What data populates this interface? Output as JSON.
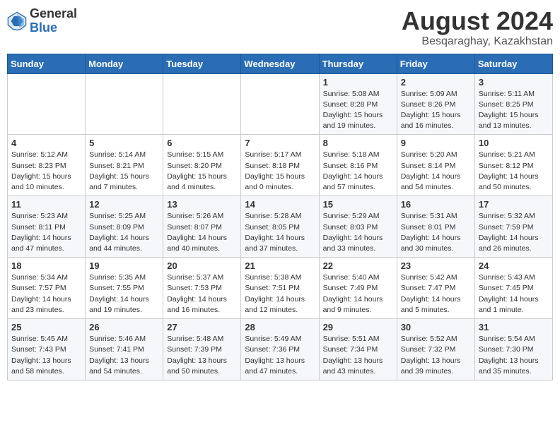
{
  "logo": {
    "general": "General",
    "blue": "Blue"
  },
  "title": "August 2024",
  "location": "Besqaraghay, Kazakhstan",
  "days_header": [
    "Sunday",
    "Monday",
    "Tuesday",
    "Wednesday",
    "Thursday",
    "Friday",
    "Saturday"
  ],
  "weeks": [
    [
      {
        "day": "",
        "info": ""
      },
      {
        "day": "",
        "info": ""
      },
      {
        "day": "",
        "info": ""
      },
      {
        "day": "",
        "info": ""
      },
      {
        "day": "1",
        "info": "Sunrise: 5:08 AM\nSunset: 8:28 PM\nDaylight: 15 hours\nand 19 minutes."
      },
      {
        "day": "2",
        "info": "Sunrise: 5:09 AM\nSunset: 8:26 PM\nDaylight: 15 hours\nand 16 minutes."
      },
      {
        "day": "3",
        "info": "Sunrise: 5:11 AM\nSunset: 8:25 PM\nDaylight: 15 hours\nand 13 minutes."
      }
    ],
    [
      {
        "day": "4",
        "info": "Sunrise: 5:12 AM\nSunset: 8:23 PM\nDaylight: 15 hours\nand 10 minutes."
      },
      {
        "day": "5",
        "info": "Sunrise: 5:14 AM\nSunset: 8:21 PM\nDaylight: 15 hours\nand 7 minutes."
      },
      {
        "day": "6",
        "info": "Sunrise: 5:15 AM\nSunset: 8:20 PM\nDaylight: 15 hours\nand 4 minutes."
      },
      {
        "day": "7",
        "info": "Sunrise: 5:17 AM\nSunset: 8:18 PM\nDaylight: 15 hours\nand 0 minutes."
      },
      {
        "day": "8",
        "info": "Sunrise: 5:18 AM\nSunset: 8:16 PM\nDaylight: 14 hours\nand 57 minutes."
      },
      {
        "day": "9",
        "info": "Sunrise: 5:20 AM\nSunset: 8:14 PM\nDaylight: 14 hours\nand 54 minutes."
      },
      {
        "day": "10",
        "info": "Sunrise: 5:21 AM\nSunset: 8:12 PM\nDaylight: 14 hours\nand 50 minutes."
      }
    ],
    [
      {
        "day": "11",
        "info": "Sunrise: 5:23 AM\nSunset: 8:11 PM\nDaylight: 14 hours\nand 47 minutes."
      },
      {
        "day": "12",
        "info": "Sunrise: 5:25 AM\nSunset: 8:09 PM\nDaylight: 14 hours\nand 44 minutes."
      },
      {
        "day": "13",
        "info": "Sunrise: 5:26 AM\nSunset: 8:07 PM\nDaylight: 14 hours\nand 40 minutes."
      },
      {
        "day": "14",
        "info": "Sunrise: 5:28 AM\nSunset: 8:05 PM\nDaylight: 14 hours\nand 37 minutes."
      },
      {
        "day": "15",
        "info": "Sunrise: 5:29 AM\nSunset: 8:03 PM\nDaylight: 14 hours\nand 33 minutes."
      },
      {
        "day": "16",
        "info": "Sunrise: 5:31 AM\nSunset: 8:01 PM\nDaylight: 14 hours\nand 30 minutes."
      },
      {
        "day": "17",
        "info": "Sunrise: 5:32 AM\nSunset: 7:59 PM\nDaylight: 14 hours\nand 26 minutes."
      }
    ],
    [
      {
        "day": "18",
        "info": "Sunrise: 5:34 AM\nSunset: 7:57 PM\nDaylight: 14 hours\nand 23 minutes."
      },
      {
        "day": "19",
        "info": "Sunrise: 5:35 AM\nSunset: 7:55 PM\nDaylight: 14 hours\nand 19 minutes."
      },
      {
        "day": "20",
        "info": "Sunrise: 5:37 AM\nSunset: 7:53 PM\nDaylight: 14 hours\nand 16 minutes."
      },
      {
        "day": "21",
        "info": "Sunrise: 5:38 AM\nSunset: 7:51 PM\nDaylight: 14 hours\nand 12 minutes."
      },
      {
        "day": "22",
        "info": "Sunrise: 5:40 AM\nSunset: 7:49 PM\nDaylight: 14 hours\nand 9 minutes."
      },
      {
        "day": "23",
        "info": "Sunrise: 5:42 AM\nSunset: 7:47 PM\nDaylight: 14 hours\nand 5 minutes."
      },
      {
        "day": "24",
        "info": "Sunrise: 5:43 AM\nSunset: 7:45 PM\nDaylight: 14 hours\nand 1 minute."
      }
    ],
    [
      {
        "day": "25",
        "info": "Sunrise: 5:45 AM\nSunset: 7:43 PM\nDaylight: 13 hours\nand 58 minutes."
      },
      {
        "day": "26",
        "info": "Sunrise: 5:46 AM\nSunset: 7:41 PM\nDaylight: 13 hours\nand 54 minutes."
      },
      {
        "day": "27",
        "info": "Sunrise: 5:48 AM\nSunset: 7:39 PM\nDaylight: 13 hours\nand 50 minutes."
      },
      {
        "day": "28",
        "info": "Sunrise: 5:49 AM\nSunset: 7:36 PM\nDaylight: 13 hours\nand 47 minutes."
      },
      {
        "day": "29",
        "info": "Sunrise: 5:51 AM\nSunset: 7:34 PM\nDaylight: 13 hours\nand 43 minutes."
      },
      {
        "day": "30",
        "info": "Sunrise: 5:52 AM\nSunset: 7:32 PM\nDaylight: 13 hours\nand 39 minutes."
      },
      {
        "day": "31",
        "info": "Sunrise: 5:54 AM\nSunset: 7:30 PM\nDaylight: 13 hours\nand 35 minutes."
      }
    ]
  ]
}
